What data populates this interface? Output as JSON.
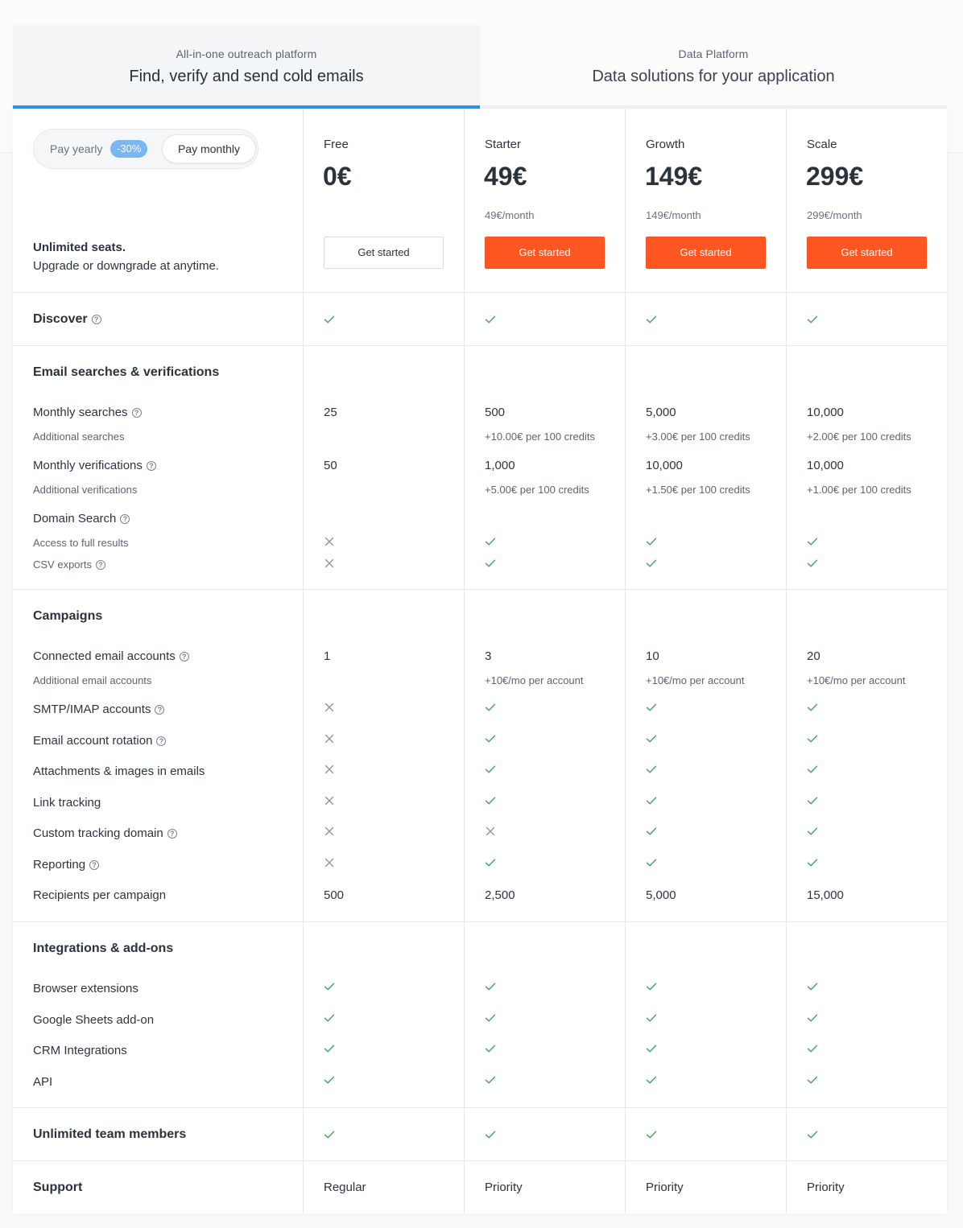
{
  "tabs": [
    {
      "subtitle": "All-in-one outreach platform",
      "title": "Find, verify and send cold emails"
    },
    {
      "subtitle": "Data Platform",
      "title": "Data solutions for your application"
    }
  ],
  "toggle": {
    "yearly_label": "Pay yearly",
    "discount": "-30%",
    "monthly_label": "Pay monthly"
  },
  "seats": {
    "bold": "Unlimited seats.",
    "text": "Upgrade or downgrade at anytime."
  },
  "plans": [
    {
      "name": "Free",
      "price": "0€",
      "per_month": "",
      "cta": "Get started"
    },
    {
      "name": "Starter",
      "price": "49€",
      "per_month": "49€/month",
      "cta": "Get started"
    },
    {
      "name": "Growth",
      "price": "149€",
      "per_month": "149€/month",
      "cta": "Get started"
    },
    {
      "name": "Scale",
      "price": "299€",
      "per_month": "299€/month",
      "cta": "Get started"
    }
  ],
  "discover": {
    "label": "Discover"
  },
  "email": {
    "title": "Email searches & verifications",
    "monthly_searches": {
      "label": "Monthly searches",
      "values": [
        "25",
        "500",
        "5,000",
        "10,000"
      ]
    },
    "additional_searches": {
      "label": "Additional searches",
      "values": [
        "",
        "+10.00€ per 100 credits",
        "+3.00€ per 100 credits",
        "+2.00€ per 100 credits"
      ]
    },
    "monthly_verifications": {
      "label": "Monthly verifications",
      "values": [
        "50",
        "1,000",
        "10,000",
        "10,000"
      ]
    },
    "additional_verifications": {
      "label": "Additional verifications",
      "values": [
        "",
        "+5.00€ per 100 credits",
        "+1.50€ per 100 credits",
        "+1.00€ per 100 credits"
      ]
    },
    "domain_search": {
      "label": "Domain Search"
    },
    "full_results": {
      "label": "Access to full results"
    },
    "csv_exports": {
      "label": "CSV exports"
    }
  },
  "campaigns": {
    "title": "Campaigns",
    "connected": {
      "label": "Connected email accounts",
      "values": [
        "1",
        "3",
        "10",
        "20"
      ]
    },
    "additional_accounts": {
      "label": "Additional email accounts",
      "values": [
        "",
        "+10€/mo per account",
        "+10€/mo per account",
        "+10€/mo per account"
      ]
    },
    "smtp": {
      "label": "SMTP/IMAP accounts"
    },
    "rotation": {
      "label": "Email account rotation"
    },
    "attachments": {
      "label": "Attachments & images in emails"
    },
    "link_tracking": {
      "label": "Link tracking"
    },
    "custom_domain": {
      "label": "Custom tracking domain"
    },
    "reporting": {
      "label": "Reporting"
    },
    "recipients": {
      "label": "Recipients per campaign",
      "values": [
        "500",
        "2,500",
        "5,000",
        "15,000"
      ]
    }
  },
  "integrations": {
    "title": "Integrations & add-ons",
    "browser": {
      "label": "Browser extensions"
    },
    "sheets": {
      "label": "Google Sheets add-on"
    },
    "crm": {
      "label": "CRM Integrations"
    },
    "api": {
      "label": "API"
    }
  },
  "team": {
    "label": "Unlimited team members"
  },
  "support": {
    "label": "Support",
    "values": [
      "Regular",
      "Priority",
      "Priority",
      "Priority"
    ]
  },
  "colors": {
    "accent": "#2b8ff0",
    "cta": "#ff5722",
    "check": "#3fa35f",
    "cross": "#8a919c"
  },
  "icons": {
    "included": "check-icon",
    "excluded": "cross-icon",
    "help": "help-icon"
  }
}
